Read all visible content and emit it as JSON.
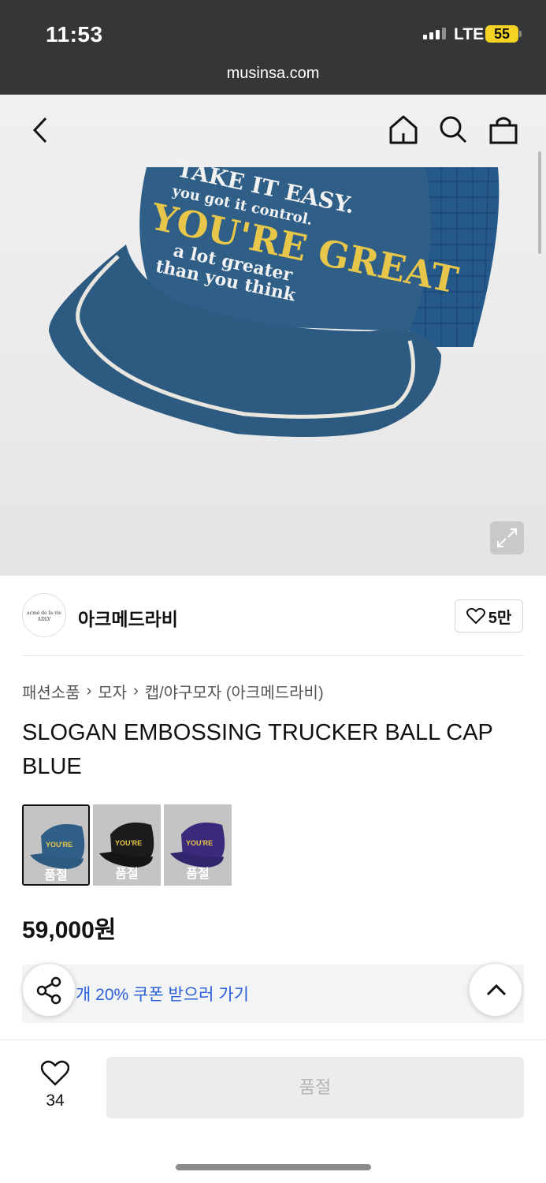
{
  "status": {
    "time": "11:53",
    "network": "LTE",
    "battery": "55"
  },
  "browser": {
    "url": "musinsa.com"
  },
  "nav": {
    "back_icon": "chevron-left-icon",
    "home_icon": "home-icon",
    "search_icon": "search-icon",
    "bag_icon": "shopping-bag-icon"
  },
  "hero": {
    "cap_text": [
      "TAKE IT EASY.",
      "you got it control.",
      "YOU'RE GREAT",
      "a lot greater",
      "than you think"
    ],
    "cap_color": "#2f5f86",
    "slogan_color": "#e8c64a",
    "expand_icon": "expand-icon"
  },
  "brand": {
    "logo_text": [
      "acmé de la vie",
      "ADLV"
    ],
    "name": "아크메드라비",
    "likes": "5만",
    "heart_icon": "heart-outline-icon"
  },
  "breadcrumb": [
    "패션소품",
    "모자",
    "캡/야구모자 (아크메드라비)"
  ],
  "product": {
    "title": "SLOGAN EMBOSSING TRUCKER BALL CAP BLUE",
    "price": "59,000원",
    "variants": [
      {
        "color": "#2f5f86",
        "status": "품절",
        "selected": true
      },
      {
        "color": "#1b1b1b",
        "status": "품절",
        "selected": false
      },
      {
        "color": "#3b2a7c",
        "status": "품절",
        "selected": false
      }
    ]
  },
  "coupon": {
    "text": "개 20% 쿠폰 받으러 가기",
    "share_icon": "share-icon",
    "up_icon": "chevron-up-icon"
  },
  "bottom_bar": {
    "like_count": "34",
    "heart_icon": "heart-outline-icon",
    "buy_label": "품절"
  }
}
